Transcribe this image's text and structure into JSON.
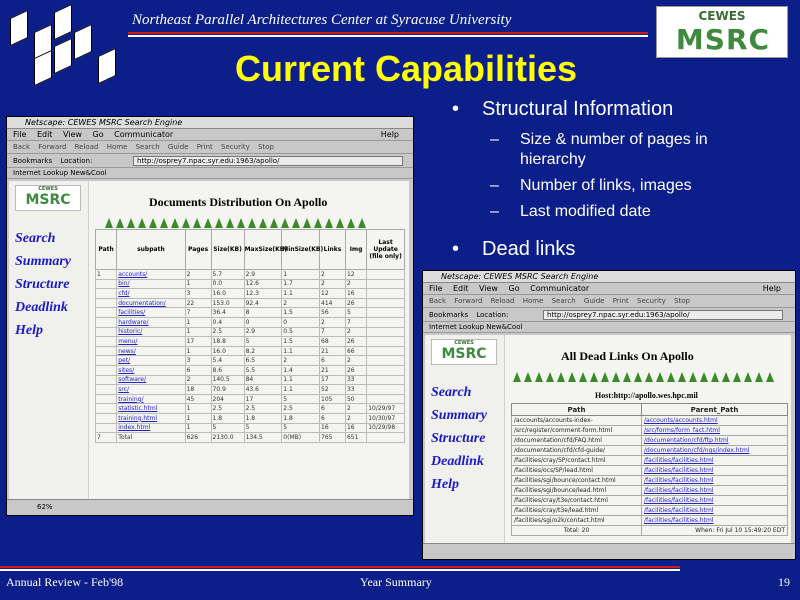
{
  "header": {
    "org": "Northeast Parallel Architectures Center at Syracuse University",
    "logo_top": "CEWES",
    "logo_main": "MSRC"
  },
  "slide": {
    "title": "Current Capabilities",
    "bullets": [
      {
        "text": "Structural Information",
        "sub": [
          "Size & number of pages in hierarchy",
          "Number of links, images",
          "Last modified date"
        ]
      },
      {
        "text": "Dead links",
        "sub": []
      }
    ]
  },
  "browser1": {
    "title": "Netscape: CEWES MSRC Search Engine",
    "menu": [
      "File",
      "Edit",
      "View",
      "Go",
      "Communicator"
    ],
    "help": "Help",
    "toolbar": [
      "Back",
      "Forward",
      "Reload",
      "Home",
      "Search",
      "Guide",
      "Print",
      "Security",
      "Stop"
    ],
    "bookmarks": "Bookmarks",
    "location_label": "Location:",
    "url": "http://osprey7.npac.syr.edu:1963/apollo/",
    "internet_row": "Internet   Lookup   New&Cool",
    "nav": [
      "Search",
      "Summary",
      "Structure",
      "Deadlink",
      "Help"
    ],
    "heading": "Documents Distribution On Apollo",
    "columns": [
      "Path",
      "subpath",
      "Pages",
      "Size(KB)",
      "MaxSize(KB)",
      "MinSize(KB)",
      "Links",
      "Img",
      "Last Update (file only)"
    ],
    "rows": [
      [
        "1",
        "accounts/",
        "2",
        "5.7",
        "2.9",
        "1",
        "2",
        "12",
        ""
      ],
      [
        "",
        "bin/",
        "1",
        "0.0",
        "12.6",
        "1.7",
        "2",
        "2",
        ""
      ],
      [
        "",
        "cfd/",
        "3",
        "16.0",
        "12.3",
        "1.1",
        "12",
        "16",
        ""
      ],
      [
        "",
        "documentation/",
        "22",
        "153.0",
        "92.4",
        "2",
        "414",
        "26",
        ""
      ],
      [
        "",
        "facilities/",
        "7",
        "36.4",
        "8",
        "1.5",
        "56",
        "5",
        ""
      ],
      [
        "",
        "hardware/",
        "1",
        "0.4",
        "0",
        "0",
        "2",
        "7",
        ""
      ],
      [
        "",
        "historic/",
        "1",
        "2.5",
        "2.9",
        "0.5",
        "7",
        "2",
        ""
      ],
      [
        "",
        "menu/",
        "17",
        "18.8",
        "5",
        "1.5",
        "68",
        "26",
        ""
      ],
      [
        "",
        "news/",
        "1",
        "16.0",
        "8.2",
        "1.1",
        "21",
        "66",
        ""
      ],
      [
        "",
        "pet/",
        "3",
        "5.4",
        "6.5",
        "2",
        "6",
        "2",
        ""
      ],
      [
        "",
        "sites/",
        "6",
        "8.6",
        "5.5",
        "1.4",
        "21",
        "26",
        ""
      ],
      [
        "",
        "software/",
        "2",
        "140.5",
        "84",
        "1.1",
        "17",
        "33",
        ""
      ],
      [
        "",
        "src/",
        "18",
        "70.9",
        "43.6",
        "1.1",
        "52",
        "33",
        ""
      ],
      [
        "",
        "training/",
        "45",
        "204",
        "17",
        "5",
        "105",
        "50",
        ""
      ],
      [
        "",
        "statistic.html",
        "1",
        "2.5",
        "2.5",
        "2.5",
        "6",
        "2",
        "10/29/97"
      ],
      [
        "",
        "training.html",
        "1",
        "1.8",
        "1.8",
        "1.8",
        "6",
        "2",
        "10/30/97"
      ],
      [
        "",
        "index.html",
        "1",
        "5",
        "5",
        "5",
        "16",
        "16",
        "10/29/98"
      ],
      [
        "7",
        "Total",
        "626",
        "2130.0",
        "134.5",
        "0(MB)",
        "765",
        "651",
        ""
      ]
    ],
    "status": "62%"
  },
  "browser2": {
    "title": "Netscape: CEWES MSRC Search Engine",
    "menu": [
      "File",
      "Edit",
      "View",
      "Go",
      "Communicator"
    ],
    "help": "Help",
    "toolbar": [
      "Back",
      "Forward",
      "Reload",
      "Home",
      "Search",
      "Guide",
      "Print",
      "Security",
      "Stop"
    ],
    "bookmarks": "Bookmarks",
    "location_label": "Location:",
    "url": "http://osprey7.npac.syr.edu:1963/apollo/",
    "internet_row": "Internet   Lookup   New&Cool",
    "nav": [
      "Search",
      "Summary",
      "Structure",
      "Deadlink",
      "Help"
    ],
    "heading": "All Dead Links On Apollo",
    "host": "Host:http://apollo.wes.hpc.mil",
    "columns": [
      "Path",
      "Parent_Path"
    ],
    "rows": [
      [
        "/accounts/accounts-index-",
        "/accounts/accounts.html"
      ],
      [
        "/src/register/comment-form.html",
        "/src/forms/form_fact.html"
      ],
      [
        "/documentation/cfd/FAQ.html",
        "/documentation/cfd/ftp.html"
      ],
      [
        "/documentation/cfd/cfd-guide/",
        "/documentation/cfd/ngs/index.html"
      ],
      [
        "/facilities/cray/SP/contact.html",
        "/facilities/facilities.html"
      ],
      [
        "/facilities/ocs/SP/lead.html",
        "/facilities/facilities.html"
      ],
      [
        "/facilities/sgi/bounce/contact.html",
        "/facilities/facilities.html"
      ],
      [
        "/facilities/sgi/bounce/lead.html",
        "/facilities/facilities.html"
      ],
      [
        "/facilities/cray/t3e/contact.html",
        "/facilities/facilities.html"
      ],
      [
        "/facilities/cray/t3e/lead.html",
        "/facilities/facilities.html"
      ],
      [
        "/facilities/sgi/o2k/contact.html",
        "/facilities/facilities.html"
      ],
      [
        "Total: 20",
        "When: Fri Jul 10 15:49:20 EDT"
      ]
    ]
  },
  "footer": {
    "left": "Annual Review - Feb'98",
    "center": "Year Summary",
    "page": "19"
  }
}
